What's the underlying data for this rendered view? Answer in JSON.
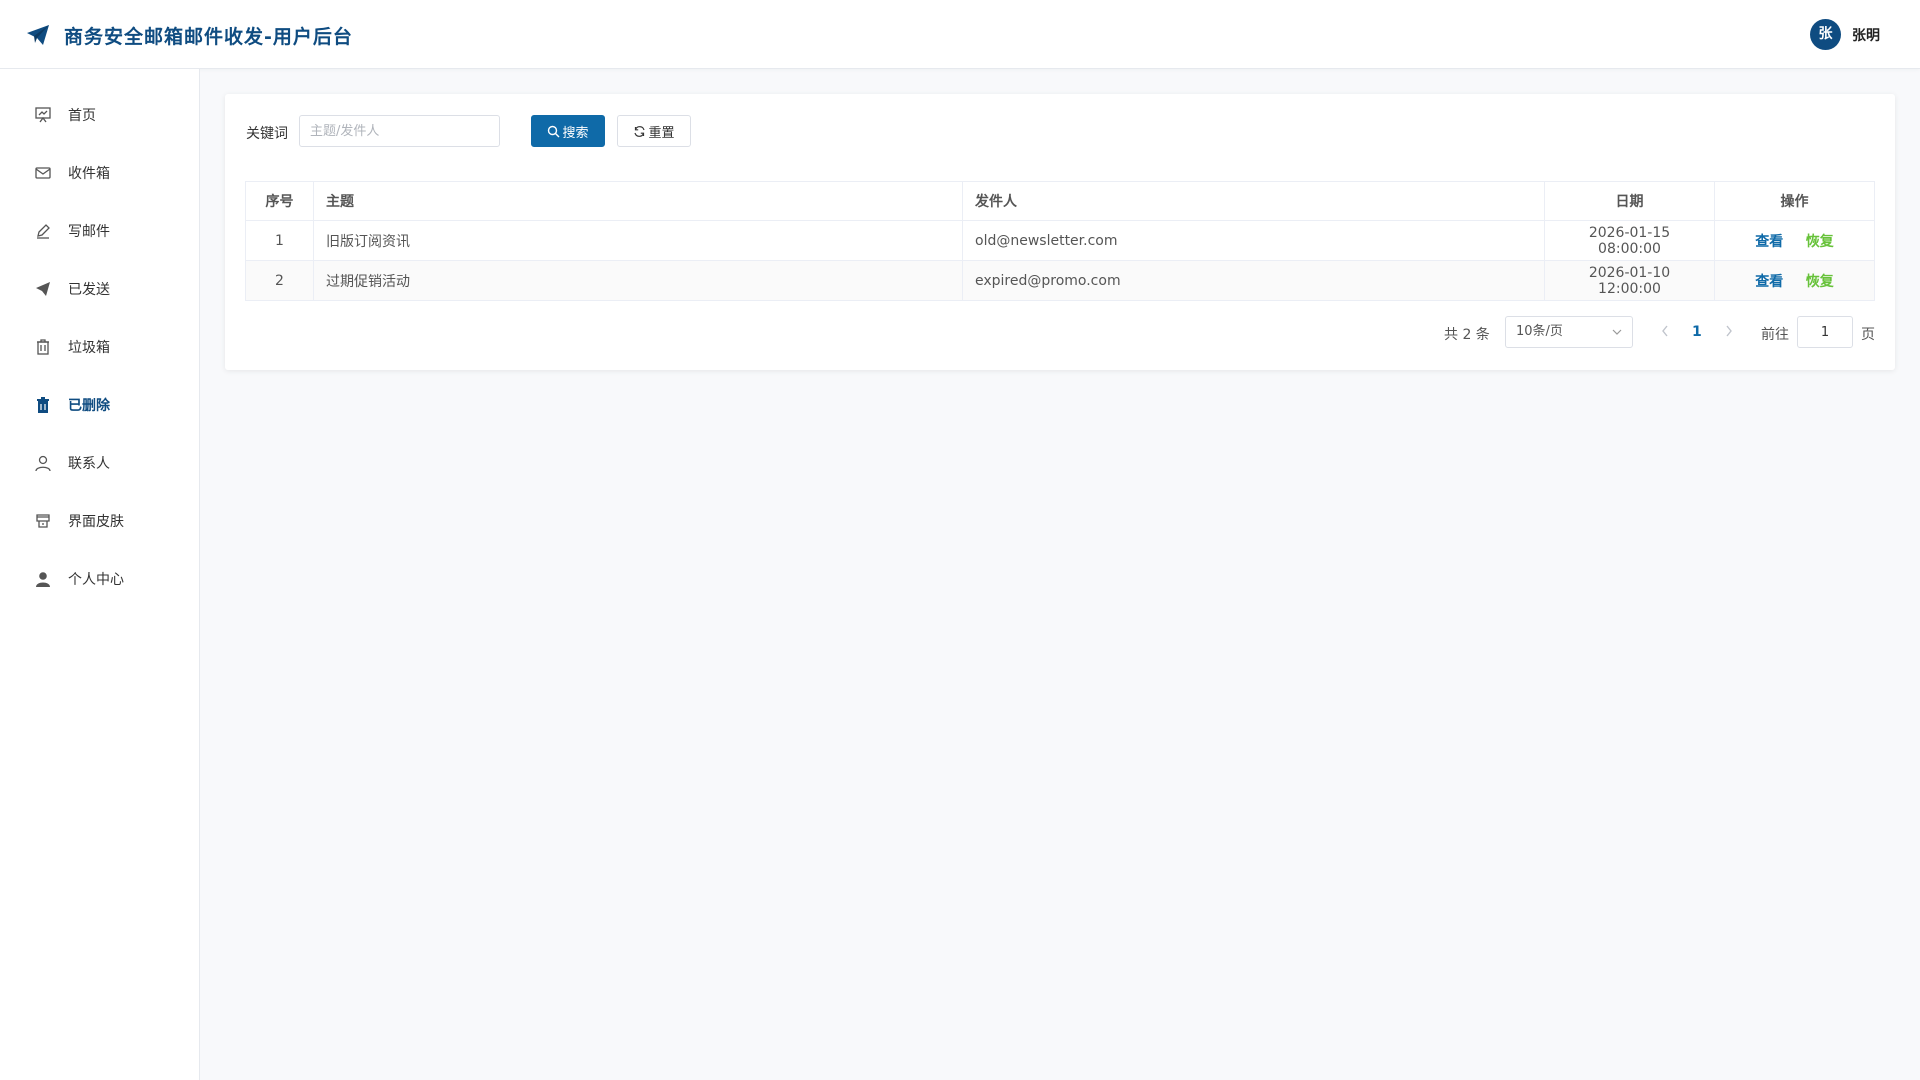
{
  "header": {
    "title": "商务安全邮箱邮件收发-用户后台",
    "avatar_text": "张",
    "user_name": "张明"
  },
  "sidebar": {
    "items": [
      {
        "label": "首页",
        "icon": "home-chart-icon"
      },
      {
        "label": "收件箱",
        "icon": "envelope-icon"
      },
      {
        "label": "写邮件",
        "icon": "pen-icon"
      },
      {
        "label": "已发送",
        "icon": "paper-plane-icon"
      },
      {
        "label": "垃圾箱",
        "icon": "trash-icon"
      },
      {
        "label": "已删除",
        "icon": "trash-filled-icon",
        "active": true
      },
      {
        "label": "联系人",
        "icon": "user-icon"
      },
      {
        "label": "界面皮肤",
        "icon": "skin-icon"
      },
      {
        "label": "个人中心",
        "icon": "user-filled-icon"
      }
    ]
  },
  "search": {
    "label": "关键词",
    "placeholder": "主题/发件人",
    "search_button": "搜索",
    "reset_button": "重置"
  },
  "table": {
    "columns": [
      "序号",
      "主题",
      "发件人",
      "日期",
      "操作"
    ],
    "rows": [
      {
        "idx": "1",
        "subject": "旧版订阅资讯",
        "from": "old@newsletter.com",
        "date": "2026-01-15 08:00:00",
        "view": "查看",
        "restore": "恢复"
      },
      {
        "idx": "2",
        "subject": "过期促销活动",
        "from": "expired@promo.com",
        "date": "2026-01-10 12:00:00",
        "view": "查看",
        "restore": "恢复"
      }
    ]
  },
  "pager": {
    "total": "共 2 条",
    "page_size": "10条/页",
    "current_page": "1",
    "goto_label": "前往",
    "jump_value": "1",
    "page_unit": "页"
  },
  "colors": {
    "brand": "#0f4c81",
    "primary": "#0f6aa8",
    "success": "#67c23a"
  }
}
